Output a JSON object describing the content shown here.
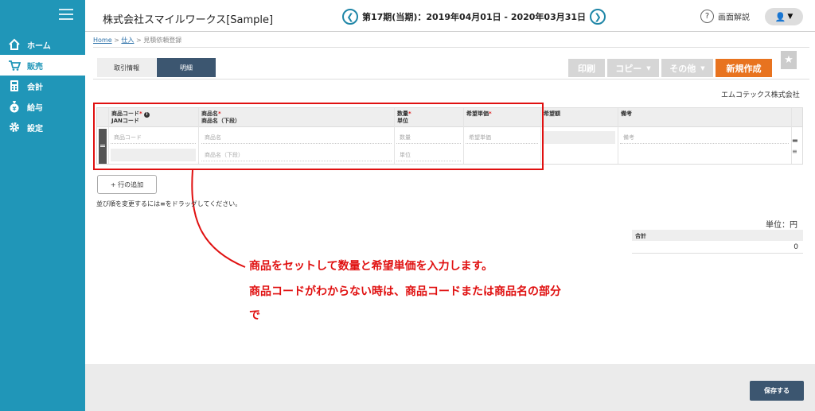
{
  "sidebar": {
    "items": [
      {
        "label": "ホーム",
        "icon": "home-icon"
      },
      {
        "label": "販売",
        "icon": "cart-icon",
        "active": true
      },
      {
        "label": "会計",
        "icon": "calculator-icon"
      },
      {
        "label": "給与",
        "icon": "money-bag-icon"
      },
      {
        "label": "設定",
        "icon": "gear-icon"
      }
    ]
  },
  "header": {
    "company": "株式会社スマイルワークス[Sample]",
    "period": "第17期(当期)：2019年04月01日 - 2020年03月31日",
    "help": "画面解説"
  },
  "breadcrumb": {
    "home": "Home",
    "sep1": " > ",
    "section": "仕入",
    "sep2": " > ",
    "current": "見積依頼登録"
  },
  "tabs": [
    {
      "label": "取引情報",
      "active": false
    },
    {
      "label": "明細",
      "active": true
    }
  ],
  "actions": {
    "print": "印刷",
    "copy": "コピー",
    "other": "その他",
    "new": "新規作成"
  },
  "supplier": "エムコテックス株式会社",
  "table": {
    "headers": {
      "code": "商品コード",
      "jan": "JANコード",
      "name": "商品名",
      "name_sub": "商品名（下段）",
      "qty": "数量",
      "unit": "単位",
      "price": "希望単価",
      "amount": "希望額",
      "note": "備考"
    },
    "placeholders": {
      "code": "商品コード",
      "name": "商品名",
      "name_sub": "商品名（下段）",
      "qty": "数量",
      "unit": "単位",
      "price": "希望単価",
      "note": "備考"
    }
  },
  "add_row": "+ 行の追加",
  "hint": "並び順を変更するには≡をドラッグしてください。",
  "unit_label": "単位：円",
  "total": {
    "label": "合計",
    "value": "0"
  },
  "annotation": {
    "line1": "商品をセットして数量と希望単価を入力します。",
    "line2": "商品コードがわからない時は、商品コードまたは商品名の部分",
    "line3": "で"
  },
  "save": "保存する",
  "colors": {
    "sidebar": "#2096b8",
    "accent_orange": "#e8731f",
    "nav_dark": "#3c5670",
    "annotation": "#e01010"
  }
}
